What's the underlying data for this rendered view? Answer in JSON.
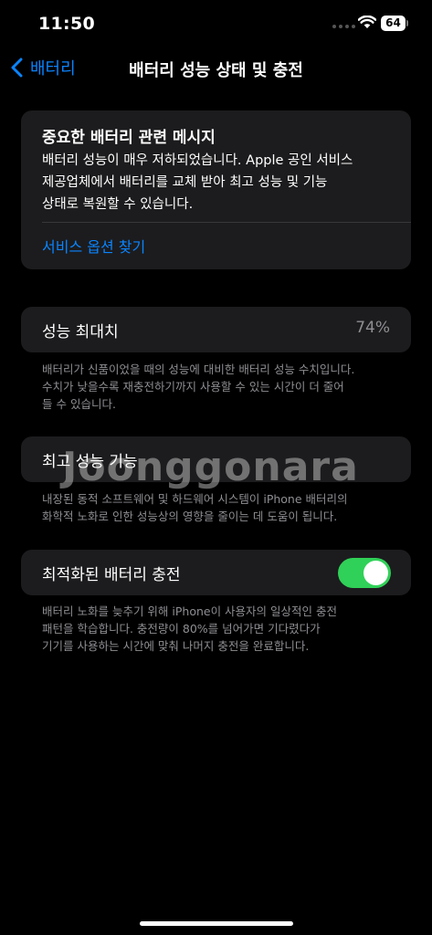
{
  "status_bar": {
    "time": "11:50",
    "battery_level": "64"
  },
  "nav": {
    "back_label": "배터리",
    "title": "배터리 성능 상태 및 충전"
  },
  "message_card": {
    "title": "중요한 배터리 관련 메시지",
    "body": "배터리 성능이 매우 저하되었습니다. Apple 공인 서비스\n제공업체에서 배터리를 교체 받아 최고 성능 및 기능\n상태로 복원할 수 있습니다.",
    "link": "서비스 옵션 찾기"
  },
  "max_capacity": {
    "label": "성능 최대치",
    "value": "74%",
    "footnote": "배터리가 신품이었을 때의 성능에 대비한 배터리 성능 수치입니다.\n수치가 낮을수록 재충전하기까지 사용할 수 있는 시간이 더 줄어\n들 수 있습니다."
  },
  "peak_performance": {
    "label": "최고 성능 기능",
    "footnote": "내장된 동적 소프트웨어 및 하드웨어 시스템이 iPhone 배터리의\n화학적 노화로 인한 성능상의 영향을 줄이는 데 도움이 됩니다."
  },
  "optimized_charging": {
    "label": "최적화된 배터리 충전",
    "enabled": true,
    "footnote": "배터리 노화를 늦추기 위해 iPhone이 사용자의 일상적인 충전\n패턴을 학습합니다. 충전량이 80%를 넘어가면 기다렸다가\n기기를 사용하는 시간에 맞춰 나머지 충전을 완료합니다."
  },
  "watermark": "Joonggonara",
  "colors": {
    "accent": "#0a84ff",
    "toggle_on": "#30d158",
    "card_bg": "#1c1c1e",
    "secondary_text": "#8e8e93"
  }
}
